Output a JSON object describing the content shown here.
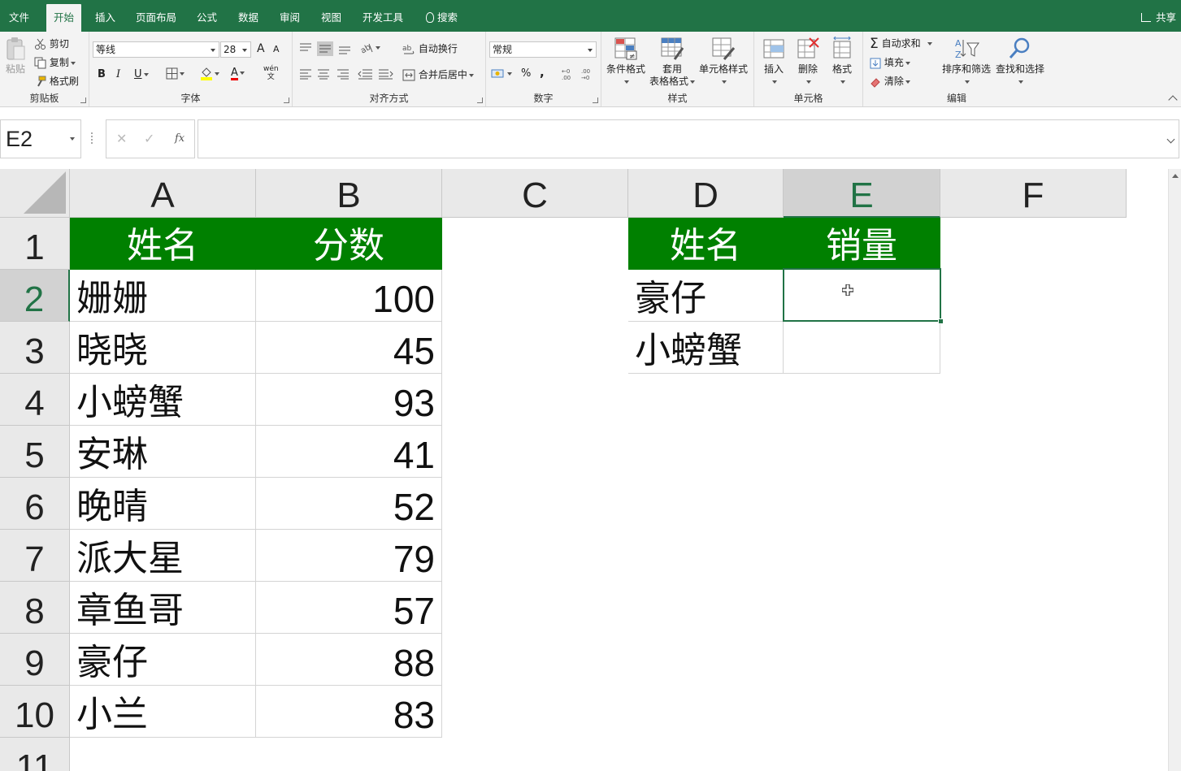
{
  "tabs": [
    {
      "label": "文件",
      "left": 0
    },
    {
      "label": "开始",
      "active": true
    },
    {
      "label": "插入"
    },
    {
      "label": "页面布局"
    },
    {
      "label": "公式"
    },
    {
      "label": "数据"
    },
    {
      "label": "审阅"
    },
    {
      "label": "视图"
    },
    {
      "label": "开发工具"
    }
  ],
  "search_label": "搜索",
  "share_label": "共享",
  "clipboard": {
    "paste": "粘贴",
    "cut": "剪切",
    "copy": "复制",
    "format_painter": "格式刷",
    "label": "剪贴板"
  },
  "font": {
    "name": "等线",
    "size": "28",
    "bold": "B",
    "italic": "I",
    "underline": "U",
    "label": "字体",
    "grow": "A",
    "shrink": "A",
    "font_color": "A",
    "phonetic_top": "wén",
    "phonetic_bottom": "文"
  },
  "alignment": {
    "wrap": "自动换行",
    "merge": "合并后居中",
    "label": "对齐方式"
  },
  "number": {
    "format": "常规",
    "percent": "%",
    "comma": ",",
    "label": "数字"
  },
  "styles": {
    "conditional": "条件格式",
    "table_line1": "套用",
    "table_line2": "表格格式",
    "cell_styles": "单元格样式",
    "label": "样式"
  },
  "cells": {
    "insert": "插入",
    "delete": "删除",
    "format": "格式",
    "label": "单元格"
  },
  "editing": {
    "autosum": "自动求和",
    "fill": "填充",
    "clear": "清除",
    "sort": "排序和筛选",
    "find": "查找和选择",
    "label": "编辑"
  },
  "formula_bar": {
    "name_box": "E2",
    "formula": ""
  },
  "columns": [
    "A",
    "B",
    "C",
    "D",
    "E",
    "F"
  ],
  "selected_column": "E",
  "rows": [
    "1",
    "2",
    "3",
    "4",
    "5",
    "6",
    "7",
    "8",
    "9",
    "10",
    "11"
  ],
  "selected_row": "2",
  "table1": {
    "headers": [
      "姓名",
      "分数"
    ],
    "rows": [
      [
        "姗姗",
        "100"
      ],
      [
        "晓晓",
        "45"
      ],
      [
        "小螃蟹",
        "93"
      ],
      [
        "安琳",
        "41"
      ],
      [
        "晚晴",
        "52"
      ],
      [
        "派大星",
        "79"
      ],
      [
        "章鱼哥",
        "57"
      ],
      [
        "豪仔",
        "88"
      ],
      [
        "小兰",
        "83"
      ]
    ]
  },
  "table2": {
    "headers": [
      "姓名",
      "销量"
    ],
    "rows": [
      [
        "豪仔",
        ""
      ],
      [
        "小螃蟹",
        ""
      ]
    ]
  },
  "colors": {
    "ribbon": "#217346",
    "header_fill": "#008000",
    "selection": "#217346"
  }
}
